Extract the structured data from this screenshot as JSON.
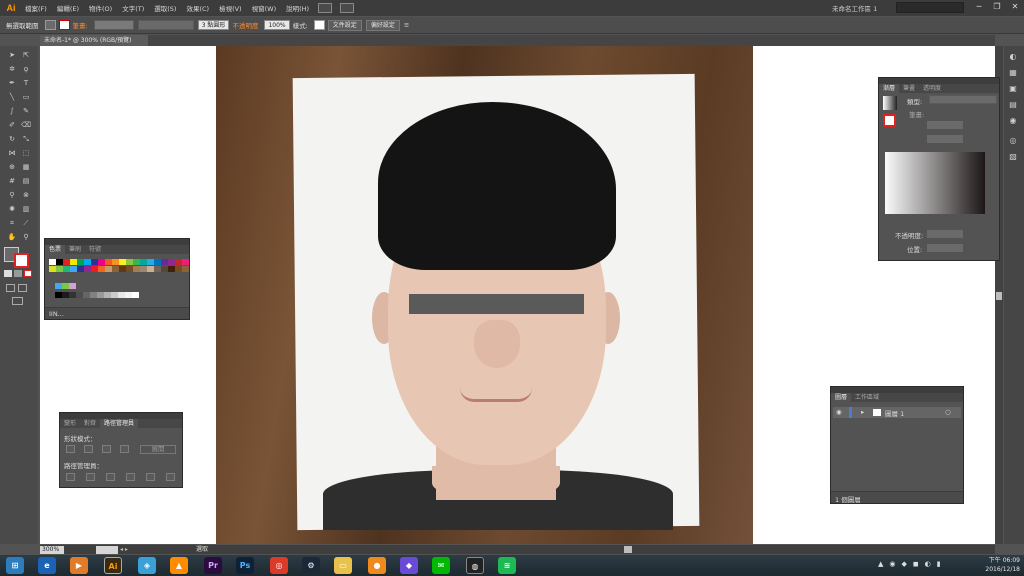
{
  "app": {
    "logo": "Ai",
    "workspace": "未命名工作區 1"
  },
  "menu": [
    "檔案(F)",
    "編輯(E)",
    "物件(O)",
    "文字(T)",
    "選取(S)",
    "效果(C)",
    "檢視(V)",
    "視窗(W)",
    "說明(H)"
  ],
  "control": {
    "selection": "無選取範圍",
    "stroke_label": "筆畫:",
    "brush": "3 點圓形",
    "opacity_label": "不透明度",
    "opacity": "100%",
    "style_label": "樣式:",
    "doc_setup": "文件設定",
    "prefs": "偏好設定"
  },
  "document": {
    "tab": "未命名-1* @ 300% (RGB/預覽)",
    "zoom": "300%",
    "page": "1",
    "status": "選取"
  },
  "swatches_panel": {
    "tabs": [
      "色票",
      "筆刷",
      "符號"
    ],
    "footer": "IIN..."
  },
  "pathfinder_panel": {
    "tabs": [
      "變形",
      "對齊",
      "路徑管理員"
    ],
    "shape_modes": "形狀模式：",
    "expand": "展開",
    "pathfinders": "路徑管理員："
  },
  "gradient_panel": {
    "tabs": [
      "漸層",
      "筆畫",
      "透明度"
    ],
    "type_label": "類型:",
    "stroke_label": "筆畫:",
    "opacity_label": "不透明度:",
    "location_label": "位置:"
  },
  "layers_panel": {
    "tabs": [
      "圖層",
      "工作區域"
    ],
    "layer_name": "圖層 1",
    "footer": "1 個圖層"
  },
  "taskbar": {
    "time": "下午 06:09",
    "date": "2016/12/18"
  },
  "colors": {
    "accent": "#ff9a00",
    "panel": "#535353",
    "ui_dark": "#3c3c3c"
  }
}
